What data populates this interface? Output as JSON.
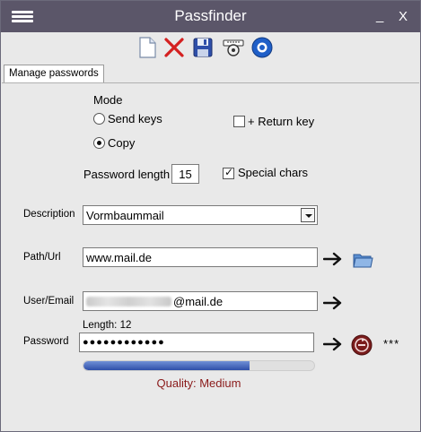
{
  "window": {
    "title": "Passfinder",
    "minimize_label": "_",
    "close_label": "X"
  },
  "toolbar": {
    "icons": [
      "new-file-icon",
      "delete-icon",
      "save-icon",
      "settings-icon",
      "about-icon"
    ]
  },
  "tab": {
    "label": "Manage passwords"
  },
  "mode": {
    "heading": "Mode",
    "send_keys_label": "Send keys",
    "copy_label": "Copy",
    "selected": "Copy",
    "return_key_label": "+ Return key",
    "return_key_checked": false
  },
  "password_length": {
    "label": "Password length",
    "value": "15"
  },
  "special_chars": {
    "label": "Special chars",
    "checked": true
  },
  "description": {
    "label": "Description",
    "value": "Vormbaummail"
  },
  "path": {
    "label": "Path/Url",
    "value": "www.mail.de"
  },
  "user": {
    "label": "User/Email",
    "visible_suffix": "@mail.de"
  },
  "password": {
    "label": "Password",
    "length_label": "Length: 12",
    "value": "●●●●●●●●●●●●",
    "reveal_label": "***"
  },
  "quality": {
    "label": "Quality: Medium",
    "level": 0.72
  },
  "colors": {
    "titlebar": "#5b5669",
    "quality_text": "#8a1a1a",
    "progress_fill": "#2f4fa9"
  }
}
